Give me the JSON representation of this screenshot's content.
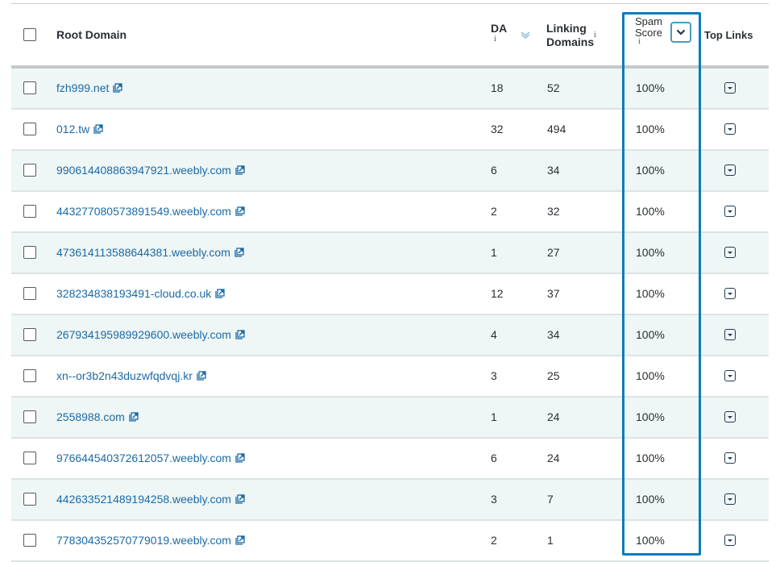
{
  "header": {
    "root_domain": "Root Domain",
    "da": "DA",
    "linking_line1": "Linking",
    "linking_line2": "Domains",
    "spam_line1": "Spam",
    "spam_line2": "Score",
    "top_links": "Top Links",
    "info_glyph": "i"
  },
  "colors": {
    "link": "#1b6aa5",
    "highlight_border": "#0a7bbd",
    "alt_row": "#eef6f6"
  },
  "rows": [
    {
      "domain": "fzh999.net",
      "da": "18",
      "linking_domains": "52",
      "spam_score": "100%"
    },
    {
      "domain": "012.tw",
      "da": "32",
      "linking_domains": "494",
      "spam_score": "100%"
    },
    {
      "domain": "990614408863947921.weebly.com",
      "da": "6",
      "linking_domains": "34",
      "spam_score": "100%"
    },
    {
      "domain": "443277080573891549.weebly.com",
      "da": "2",
      "linking_domains": "32",
      "spam_score": "100%"
    },
    {
      "domain": "473614113588644381.weebly.com",
      "da": "1",
      "linking_domains": "27",
      "spam_score": "100%"
    },
    {
      "domain": "328234838193491-cloud.co.uk",
      "da": "12",
      "linking_domains": "37",
      "spam_score": "100%"
    },
    {
      "domain": "267934195989929600.weebly.com",
      "da": "4",
      "linking_domains": "34",
      "spam_score": "100%"
    },
    {
      "domain": "xn--or3b2n43duzwfqdvqj.kr",
      "da": "3",
      "linking_domains": "25",
      "spam_score": "100%"
    },
    {
      "domain": "2558988.com",
      "da": "1",
      "linking_domains": "24",
      "spam_score": "100%"
    },
    {
      "domain": "976644540372612057.weebly.com",
      "da": "6",
      "linking_domains": "24",
      "spam_score": "100%"
    },
    {
      "domain": "442633521489194258.weebly.com",
      "da": "3",
      "linking_domains": "7",
      "spam_score": "100%"
    },
    {
      "domain": "778304352570779019.weebly.com",
      "da": "2",
      "linking_domains": "1",
      "spam_score": "100%"
    }
  ]
}
